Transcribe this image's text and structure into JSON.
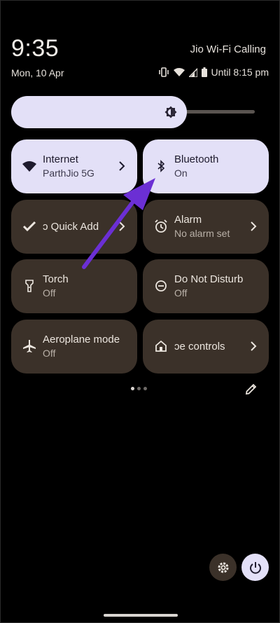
{
  "status_bar": {
    "time": "9:35",
    "date": "Mon, 10 Apr",
    "carrier": "Jio Wi-Fi Calling",
    "battery_text": "Until 8:15 pm",
    "icons": [
      "vibrate-icon",
      "wifi-icon",
      "signal-icon",
      "battery-icon"
    ]
  },
  "brightness": {
    "level": 0.72,
    "icon": "brightness-icon",
    "fill_color": "#e3e0f7"
  },
  "tiles": [
    {
      "title": "Internet",
      "subtitle": "ParthJio 5G",
      "icon": "wifi-icon",
      "active": true,
      "chevron": true
    },
    {
      "title": "Bluetooth",
      "subtitle": "On",
      "icon": "bluetooth-icon",
      "active": true,
      "chevron": false
    },
    {
      "title": "ɔ Quick Add",
      "subtitle": "",
      "icon": "check-icon",
      "active": false,
      "chevron": true
    },
    {
      "title": "Alarm",
      "subtitle": "No alarm set",
      "icon": "alarm-icon",
      "active": false,
      "chevron": true
    },
    {
      "title": "Torch",
      "subtitle": "Off",
      "icon": "torch-icon",
      "active": false,
      "chevron": false
    },
    {
      "title": "Do Not Disturb",
      "subtitle": "Off",
      "icon": "dnd-icon",
      "active": false,
      "chevron": false
    },
    {
      "title": "Aeroplane mode",
      "subtitle": "Off",
      "icon": "airplane-icon",
      "active": false,
      "chevron": false
    },
    {
      "title": "ɔe controls",
      "subtitle": "",
      "icon": "home-icon",
      "active": false,
      "chevron": true
    }
  ],
  "pager": {
    "pages": 3,
    "current": 1
  },
  "bottom_buttons": {
    "settings_icon": "gear-icon",
    "power_icon": "power-icon"
  },
  "colors": {
    "tile_active": "#e3e0f7",
    "tile_inactive": "#3b3129",
    "annotation_arrow": "#6b2fd4"
  }
}
